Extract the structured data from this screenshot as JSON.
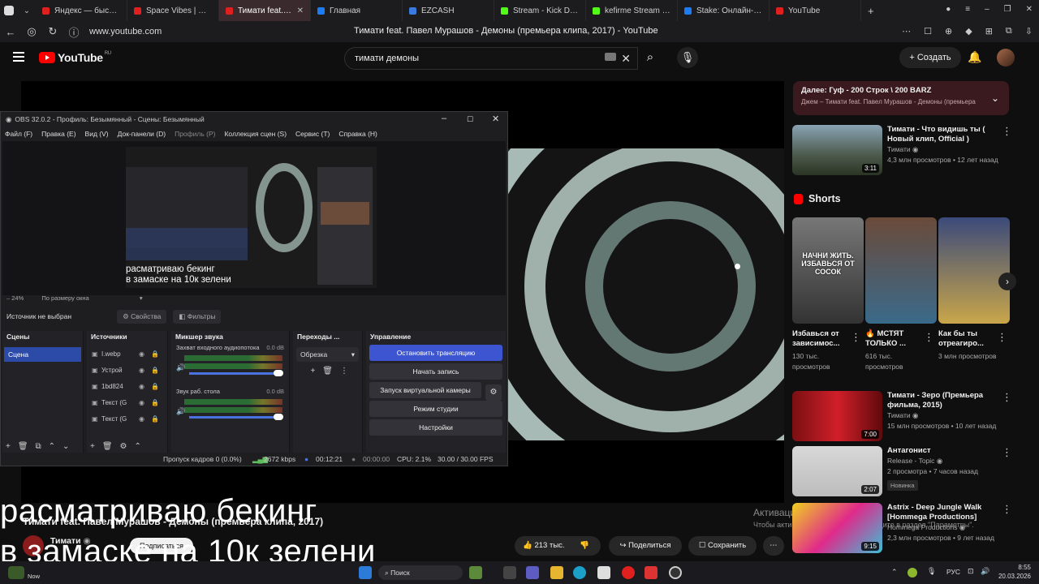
{
  "browser": {
    "tabs": [
      {
        "label": "Яндекс — быстрый п",
        "color": "#e0201f"
      },
      {
        "label": "Space Vibes | Melodic",
        "color": "#e0201f"
      },
      {
        "label": "Тимати feat. Павел",
        "color": "#e0201f",
        "active": true
      },
      {
        "label": "Главная",
        "color": "#1e7cf2"
      },
      {
        "label": "EZCASH",
        "color": "#3a7ae0"
      },
      {
        "label": "Stream - Kick Dashbo",
        "color": "#53fc18"
      },
      {
        "label": "kefirme Stream - Wat",
        "color": "#53fc18"
      },
      {
        "label": "Stake: Онлайн-казин",
        "color": "#1e7cf2"
      },
      {
        "label": "YouTube",
        "color": "#e0201f"
      }
    ],
    "url": "www.youtube.com",
    "page_title": "Тимати feat. Павел Мурашов - Демоны (премьера клипа, 2017) - YouTube"
  },
  "youtube": {
    "logo_text": "YouTube",
    "logo_region": "RU",
    "search_value": "тимати демоны",
    "create_label": "Создать"
  },
  "obs": {
    "title": "OBS 32.0.2 - Профиль: Безымянный - Сцены: Безымянный",
    "menu": [
      "Файл (F)",
      "Правка (E)",
      "Вид (V)",
      "Док-панели (D)",
      "Профиль (P)",
      "Коллекция сцен (S)",
      "Сервис (T)",
      "Справка (H)"
    ],
    "preview_text_1": "расматриваю бекинг",
    "preview_text_2": "в замаске на 10к зелени",
    "zoom": "24%",
    "zoom_mode": "По размеру окна",
    "no_source": "Источник не выбран",
    "properties": "Свойства",
    "filters": "Фильтры",
    "docks": {
      "scenes": "Сцены",
      "sources": "Источники",
      "mixer": "Микшер звука",
      "transitions": "Переходы ...",
      "controls": "Управление"
    },
    "scene_item": "Сцена",
    "sources": [
      "I.webp",
      "Устрой",
      "1bd824",
      "Текст (G",
      "Текст (G"
    ],
    "mixer_tracks": [
      {
        "name": "Захват входного аудиопотока",
        "db": "0.0 dB"
      },
      {
        "name": "Звук раб. стола",
        "db": "0.0 dB"
      }
    ],
    "transition": "Обрезка",
    "controls": [
      "Остановить трансляцию",
      "Начать запись",
      "Запуск виртуальной камеры",
      "Режим студии",
      "Настройки"
    ],
    "status": {
      "dropped": "Пропуск кадров 0 (0.0%)",
      "bitrate": "2672 kbps",
      "live_time": "00:12:21",
      "rec_time": "00:00:00",
      "cpu": "CPU: 2.1%",
      "fps": "30.00 / 30.00 FPS"
    }
  },
  "sidebar": {
    "up_next_title": "Далее: Гуф - 200 Строк \\ 200 BARZ",
    "up_next_sub": "Джем – Тимати feat. Павел Мурашов - Демоны (премьера",
    "videos": [
      {
        "title": "Тимати - Что видишь ты ( Новый клип, Official )",
        "channel": "Тимати",
        "stats": "4,3 млн просмотров • 12 лет назад",
        "duration": "3:11"
      },
      {
        "title": "Тимати - Зеро (Премьера фильма, 2015)",
        "channel": "Тимати",
        "stats": "15 млн просмотров • 10 лет назад",
        "duration": "7:00"
      },
      {
        "title": "Антагонист",
        "channel": "Release - Topic",
        "stats": "2 просмотра • 7 часов назад",
        "badge": "Новинка",
        "duration": "2:07"
      },
      {
        "title": "Astrix - Deep Jungle Walk [Hommega Productions]",
        "channel": "Hommega Productions",
        "stats": "2,3 млн просмотров • 9 лет назад",
        "duration": "9:15"
      }
    ],
    "shorts_label": "Shorts",
    "shorts": [
      {
        "title": "Избавься от зависимос...",
        "views": "130 тыс. просмотров",
        "thumb_text": "НАЧНИ ЖИТЬ. ИЗБАВЬСЯ ОТ СОСОК"
      },
      {
        "title": "🔥 МСТЯТ ТОЛЬКО ...",
        "views": "616 тыс. просмотров"
      },
      {
        "title": "Как бы ты отреагиро...",
        "views": "3 млн просмотров"
      }
    ]
  },
  "video_below": {
    "title": "Тимати feat. Павел Мурашов - Демоны (премьера клипа, 2017)",
    "channel": "Тимати",
    "subscribe": "Подписаться",
    "likes": "213 тыс.",
    "share": "Поделиться",
    "save": "Сохранить"
  },
  "overlay": {
    "line1": "расматриваю бекинг",
    "line2": "в замаске  на 10к зелени",
    "activation": "Активация Windows",
    "activation_sub": "Чтобы активировать Windows, перейдите в раздел \"Параметры\"."
  },
  "taskbar": {
    "search": "Поиск",
    "lang": "РУС",
    "time": "8:55",
    "date": "20.03.2026",
    "weather_line2": "Now"
  }
}
